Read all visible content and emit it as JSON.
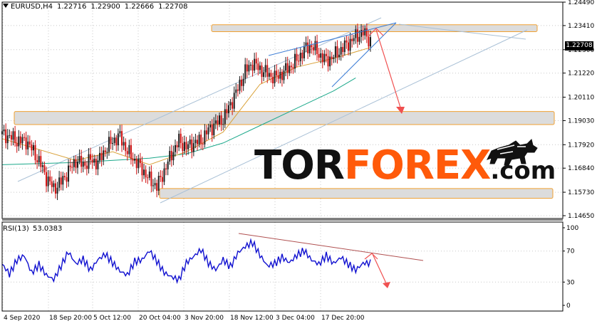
{
  "header": {
    "symbol": "EURUSD,H4",
    "open": "1.22716",
    "high": "1.22900",
    "low": "1.22666",
    "close": "1.22708"
  },
  "current_price": "1.22708",
  "rsi_header": {
    "label": "RSI(13)",
    "value": "53.0383"
  },
  "logo": {
    "part1": "TOR",
    "part2": "FOREX",
    "part3": ".com"
  },
  "colors": {
    "candle_up": "#1d1d1d",
    "candle_down": "#d01010",
    "ma_fast": "#d9a23a",
    "ma_slow": "#1aa88a",
    "channel": "#a9c0d6",
    "trend": "#3a7bd5",
    "zone_fill": "#dcdcdc",
    "zone_border": "#f0a030",
    "arrow": "#f05050",
    "rsi_line": "#1010d0",
    "rsi_trend": "#b05050",
    "logo_orange": "#ff5a0a"
  },
  "chart_data": [
    {
      "type": "candlestick",
      "title": "EURUSD,H4",
      "y_ticks": [
        "1.24490",
        "1.23410",
        "1.22300",
        "1.21220",
        "1.20110",
        "1.19030",
        "1.17920",
        "1.16840",
        "1.15730",
        "1.14650"
      ],
      "ylim": [
        1.1465,
        1.2449
      ],
      "x_ticks": [
        "4 Sep 2020",
        "18 Sep 20:00",
        "5 Oct 12:00",
        "20 Oct 04:00",
        "3 Nov 20:00",
        "18 Nov 12:00",
        "3 Dec 04:00",
        "17 Dec 20:00"
      ],
      "close_path": [
        [
          0,
          1.184
        ],
        [
          4,
          1.183
        ],
        [
          8,
          1.181
        ],
        [
          13,
          1.181
        ],
        [
          17,
          1.176
        ],
        [
          21,
          1.17
        ],
        [
          24,
          1.164
        ],
        [
          28,
          1.159
        ],
        [
          32,
          1.162
        ],
        [
          36,
          1.167
        ],
        [
          40,
          1.172
        ],
        [
          44,
          1.17
        ],
        [
          48,
          1.172
        ],
        [
          52,
          1.171
        ],
        [
          56,
          1.177
        ],
        [
          60,
          1.181
        ],
        [
          64,
          1.183
        ],
        [
          68,
          1.176
        ],
        [
          72,
          1.172
        ],
        [
          76,
          1.168
        ],
        [
          80,
          1.163
        ],
        [
          84,
          1.16
        ],
        [
          88,
          1.167
        ],
        [
          92,
          1.175
        ],
        [
          96,
          1.181
        ],
        [
          100,
          1.178
        ],
        [
          104,
          1.18
        ],
        [
          108,
          1.181
        ],
        [
          112,
          1.186
        ],
        [
          116,
          1.189
        ],
        [
          120,
          1.191
        ],
        [
          124,
          1.198
        ],
        [
          128,
          1.205
        ],
        [
          132,
          1.213
        ],
        [
          136,
          1.217
        ],
        [
          140,
          1.214
        ],
        [
          144,
          1.212
        ],
        [
          148,
          1.21
        ],
        [
          152,
          1.212
        ],
        [
          156,
          1.215
        ],
        [
          160,
          1.218
        ],
        [
          164,
          1.223
        ],
        [
          168,
          1.225
        ],
        [
          172,
          1.221
        ],
        [
          176,
          1.218
        ],
        [
          180,
          1.22
        ],
        [
          184,
          1.223
        ],
        [
          188,
          1.226
        ],
        [
          192,
          1.229
        ],
        [
          196,
          1.231
        ],
        [
          200,
          1.227
        ]
      ],
      "ma_fast": [
        [
          0,
          1.182
        ],
        [
          40,
          1.172
        ],
        [
          60,
          1.176
        ],
        [
          80,
          1.17
        ],
        [
          100,
          1.176
        ],
        [
          120,
          1.185
        ],
        [
          140,
          1.207
        ],
        [
          160,
          1.215
        ],
        [
          180,
          1.219
        ],
        [
          200,
          1.224
        ]
      ],
      "ma_slow": [
        [
          0,
          1.17
        ],
        [
          40,
          1.171
        ],
        [
          80,
          1.173
        ],
        [
          100,
          1.175
        ],
        [
          120,
          1.18
        ],
        [
          140,
          1.188
        ],
        [
          160,
          1.196
        ],
        [
          180,
          1.204
        ],
        [
          192,
          1.21
        ]
      ],
      "zones": [
        {
          "from": 1.2313,
          "to": 1.2345
        },
        {
          "from": 1.1885,
          "to": 1.1945
        },
        {
          "from": 1.1545,
          "to": 1.159
        }
      ],
      "current_price": 1.22708
    },
    {
      "type": "line",
      "title": "RSI(13) 53.0383",
      "y_ticks": [
        "100",
        "70",
        "30",
        "0"
      ],
      "ylim": [
        0,
        100
      ],
      "series": [
        {
          "values": [
            [
              0,
              50
            ],
            [
              4,
              38
            ],
            [
              8,
              58
            ],
            [
              12,
              66
            ],
            [
              16,
              45
            ],
            [
              20,
              55
            ],
            [
              24,
              40
            ],
            [
              28,
              32
            ],
            [
              32,
              48
            ],
            [
              36,
              66
            ],
            [
              40,
              52
            ],
            [
              44,
              60
            ],
            [
              48,
              48
            ],
            [
              52,
              62
            ],
            [
              56,
              68
            ],
            [
              60,
              55
            ],
            [
              64,
              42
            ],
            [
              68,
              36
            ],
            [
              72,
              54
            ],
            [
              76,
              58
            ],
            [
              80,
              72
            ],
            [
              84,
              60
            ],
            [
              88,
              45
            ],
            [
              92,
              38
            ],
            [
              96,
              32
            ],
            [
              100,
              52
            ],
            [
              104,
              60
            ],
            [
              108,
              70
            ],
            [
              112,
              55
            ],
            [
              116,
              48
            ],
            [
              120,
              62
            ],
            [
              124,
              52
            ],
            [
              128,
              68
            ],
            [
              132,
              74
            ],
            [
              136,
              78
            ],
            [
              140,
              62
            ],
            [
              144,
              50
            ],
            [
              148,
              55
            ],
            [
              152,
              65
            ],
            [
              156,
              58
            ],
            [
              160,
              66
            ],
            [
              164,
              70
            ],
            [
              168,
              56
            ],
            [
              172,
              50
            ],
            [
              176,
              62
            ],
            [
              180,
              54
            ],
            [
              184,
              64
            ],
            [
              188,
              56
            ],
            [
              192,
              48
            ],
            [
              196,
              55
            ],
            [
              200,
              53
            ]
          ]
        }
      ]
    }
  ]
}
